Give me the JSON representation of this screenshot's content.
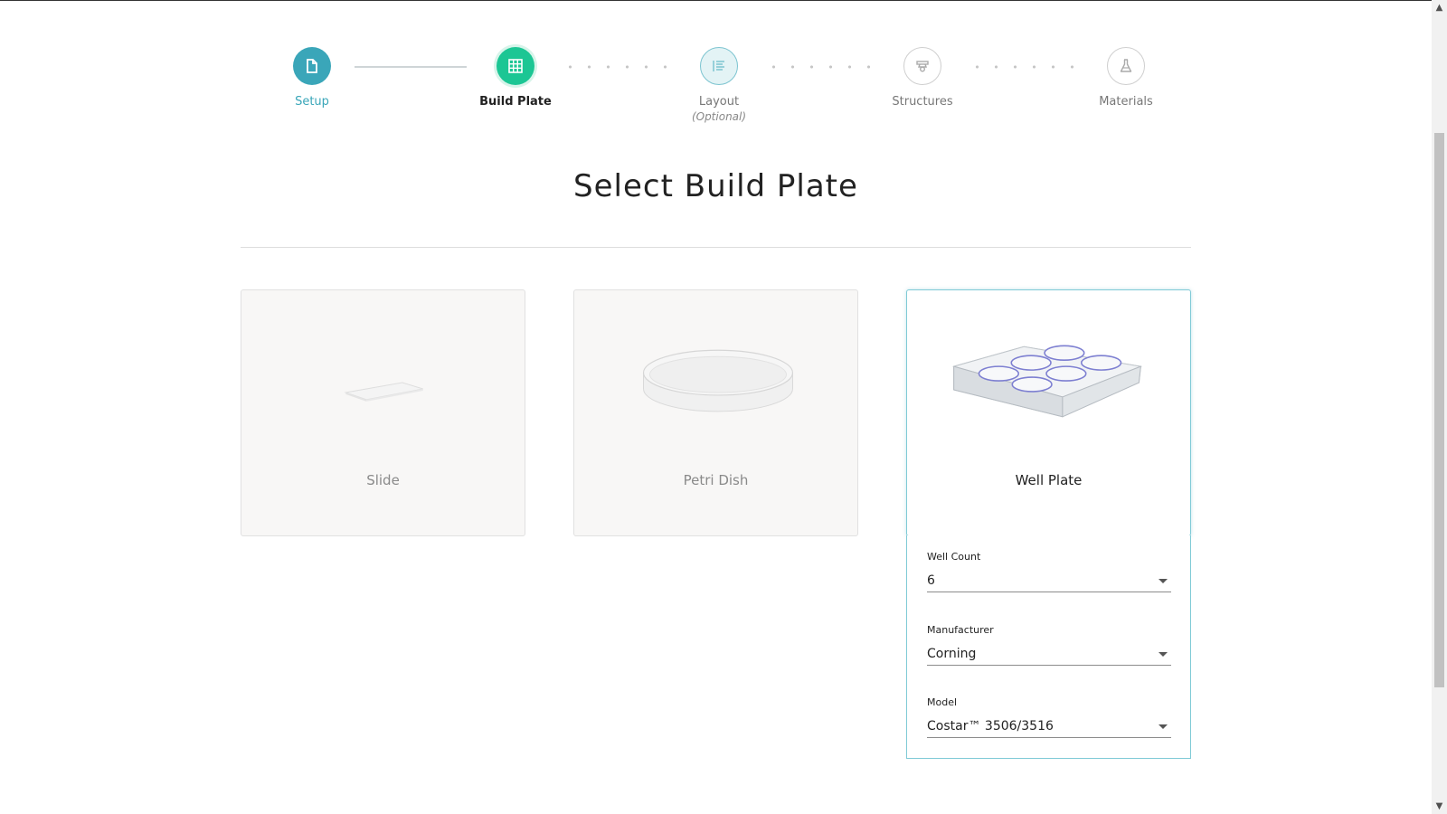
{
  "stepper": {
    "steps": [
      {
        "label": "Setup",
        "state": "done",
        "icon": "document-icon"
      },
      {
        "label": "Build Plate",
        "state": "active",
        "icon": "grid-icon"
      },
      {
        "label": "Layout",
        "sub": "(Optional)",
        "state": "next",
        "icon": "layout-list-icon"
      },
      {
        "label": "Structures",
        "state": "todo",
        "icon": "printer-icon"
      },
      {
        "label": "Materials",
        "state": "todo",
        "icon": "flask-icon"
      }
    ]
  },
  "page": {
    "title": "Select Build Plate"
  },
  "plates": [
    {
      "label": "Slide",
      "selected": false
    },
    {
      "label": "Petri Dish",
      "selected": false
    },
    {
      "label": "Well Plate",
      "selected": true
    }
  ],
  "options": {
    "well_count": {
      "label": "Well Count",
      "value": "6"
    },
    "manufacturer": {
      "label": "Manufacturer",
      "value": "Corning"
    },
    "model": {
      "label": "Model",
      "value": "Costar™ 3506/3516"
    }
  },
  "colors": {
    "done": "#3aa6b9",
    "active": "#1cc694",
    "selected_border": "#7fcad6"
  }
}
